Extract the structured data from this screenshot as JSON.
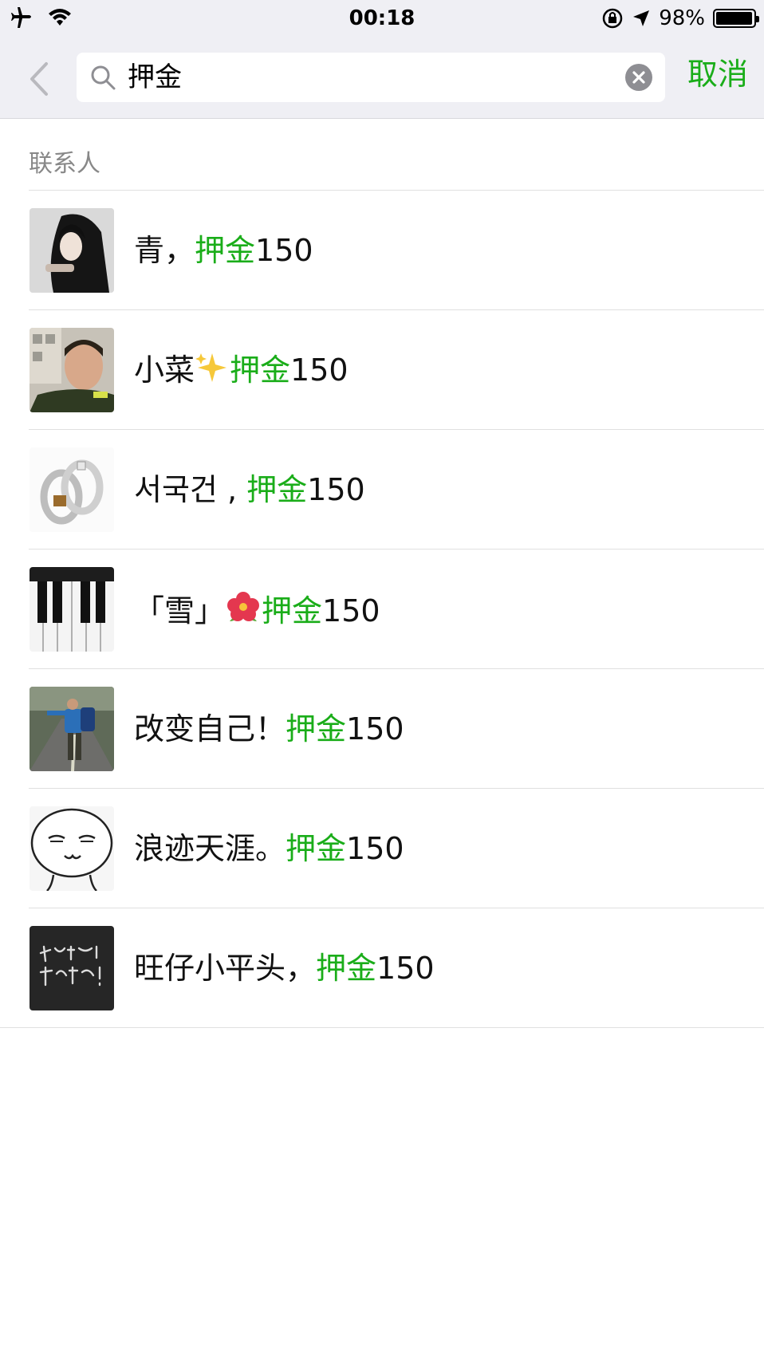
{
  "status_bar": {
    "time": "00:18",
    "battery_percent": "98%",
    "icons": [
      "airplane-icon",
      "wifi-icon",
      "rotation-lock-icon",
      "location-icon",
      "battery-icon"
    ]
  },
  "search": {
    "query": "押金",
    "cancel_label": "取消"
  },
  "section": {
    "title": "联系人"
  },
  "contacts": [
    {
      "prefix": "青，",
      "emoji": "",
      "highlight": "押金",
      "suffix": "150",
      "avatar": "photo-woman-dark-hair"
    },
    {
      "prefix": "小菜",
      "emoji": "sparkles",
      "highlight": "押金",
      "suffix": "150",
      "avatar": "photo-man-selfie"
    },
    {
      "prefix": "서국건 , ",
      "emoji": "",
      "highlight": "押金",
      "suffix": "150",
      "avatar": "photo-silver-rings"
    },
    {
      "prefix": "「雪」",
      "emoji": "hibiscus",
      "highlight": "押金",
      "suffix": "150",
      "avatar": "photo-piano-keys"
    },
    {
      "prefix": "改变自己！",
      "emoji": "",
      "highlight": "押金",
      "suffix": "150",
      "avatar": "photo-hiker-road"
    },
    {
      "prefix": "浪迹天涯。",
      "emoji": "",
      "highlight": "押金",
      "suffix": "150",
      "avatar": "drawing-smug-face"
    },
    {
      "prefix": "旺仔小平头，",
      "emoji": "",
      "highlight": "押金",
      "suffix": "150",
      "avatar": "chalkboard-text"
    }
  ],
  "colors": {
    "accent": "#1aad19",
    "header_bg": "#efeff4",
    "divider": "#e0e0e0"
  }
}
